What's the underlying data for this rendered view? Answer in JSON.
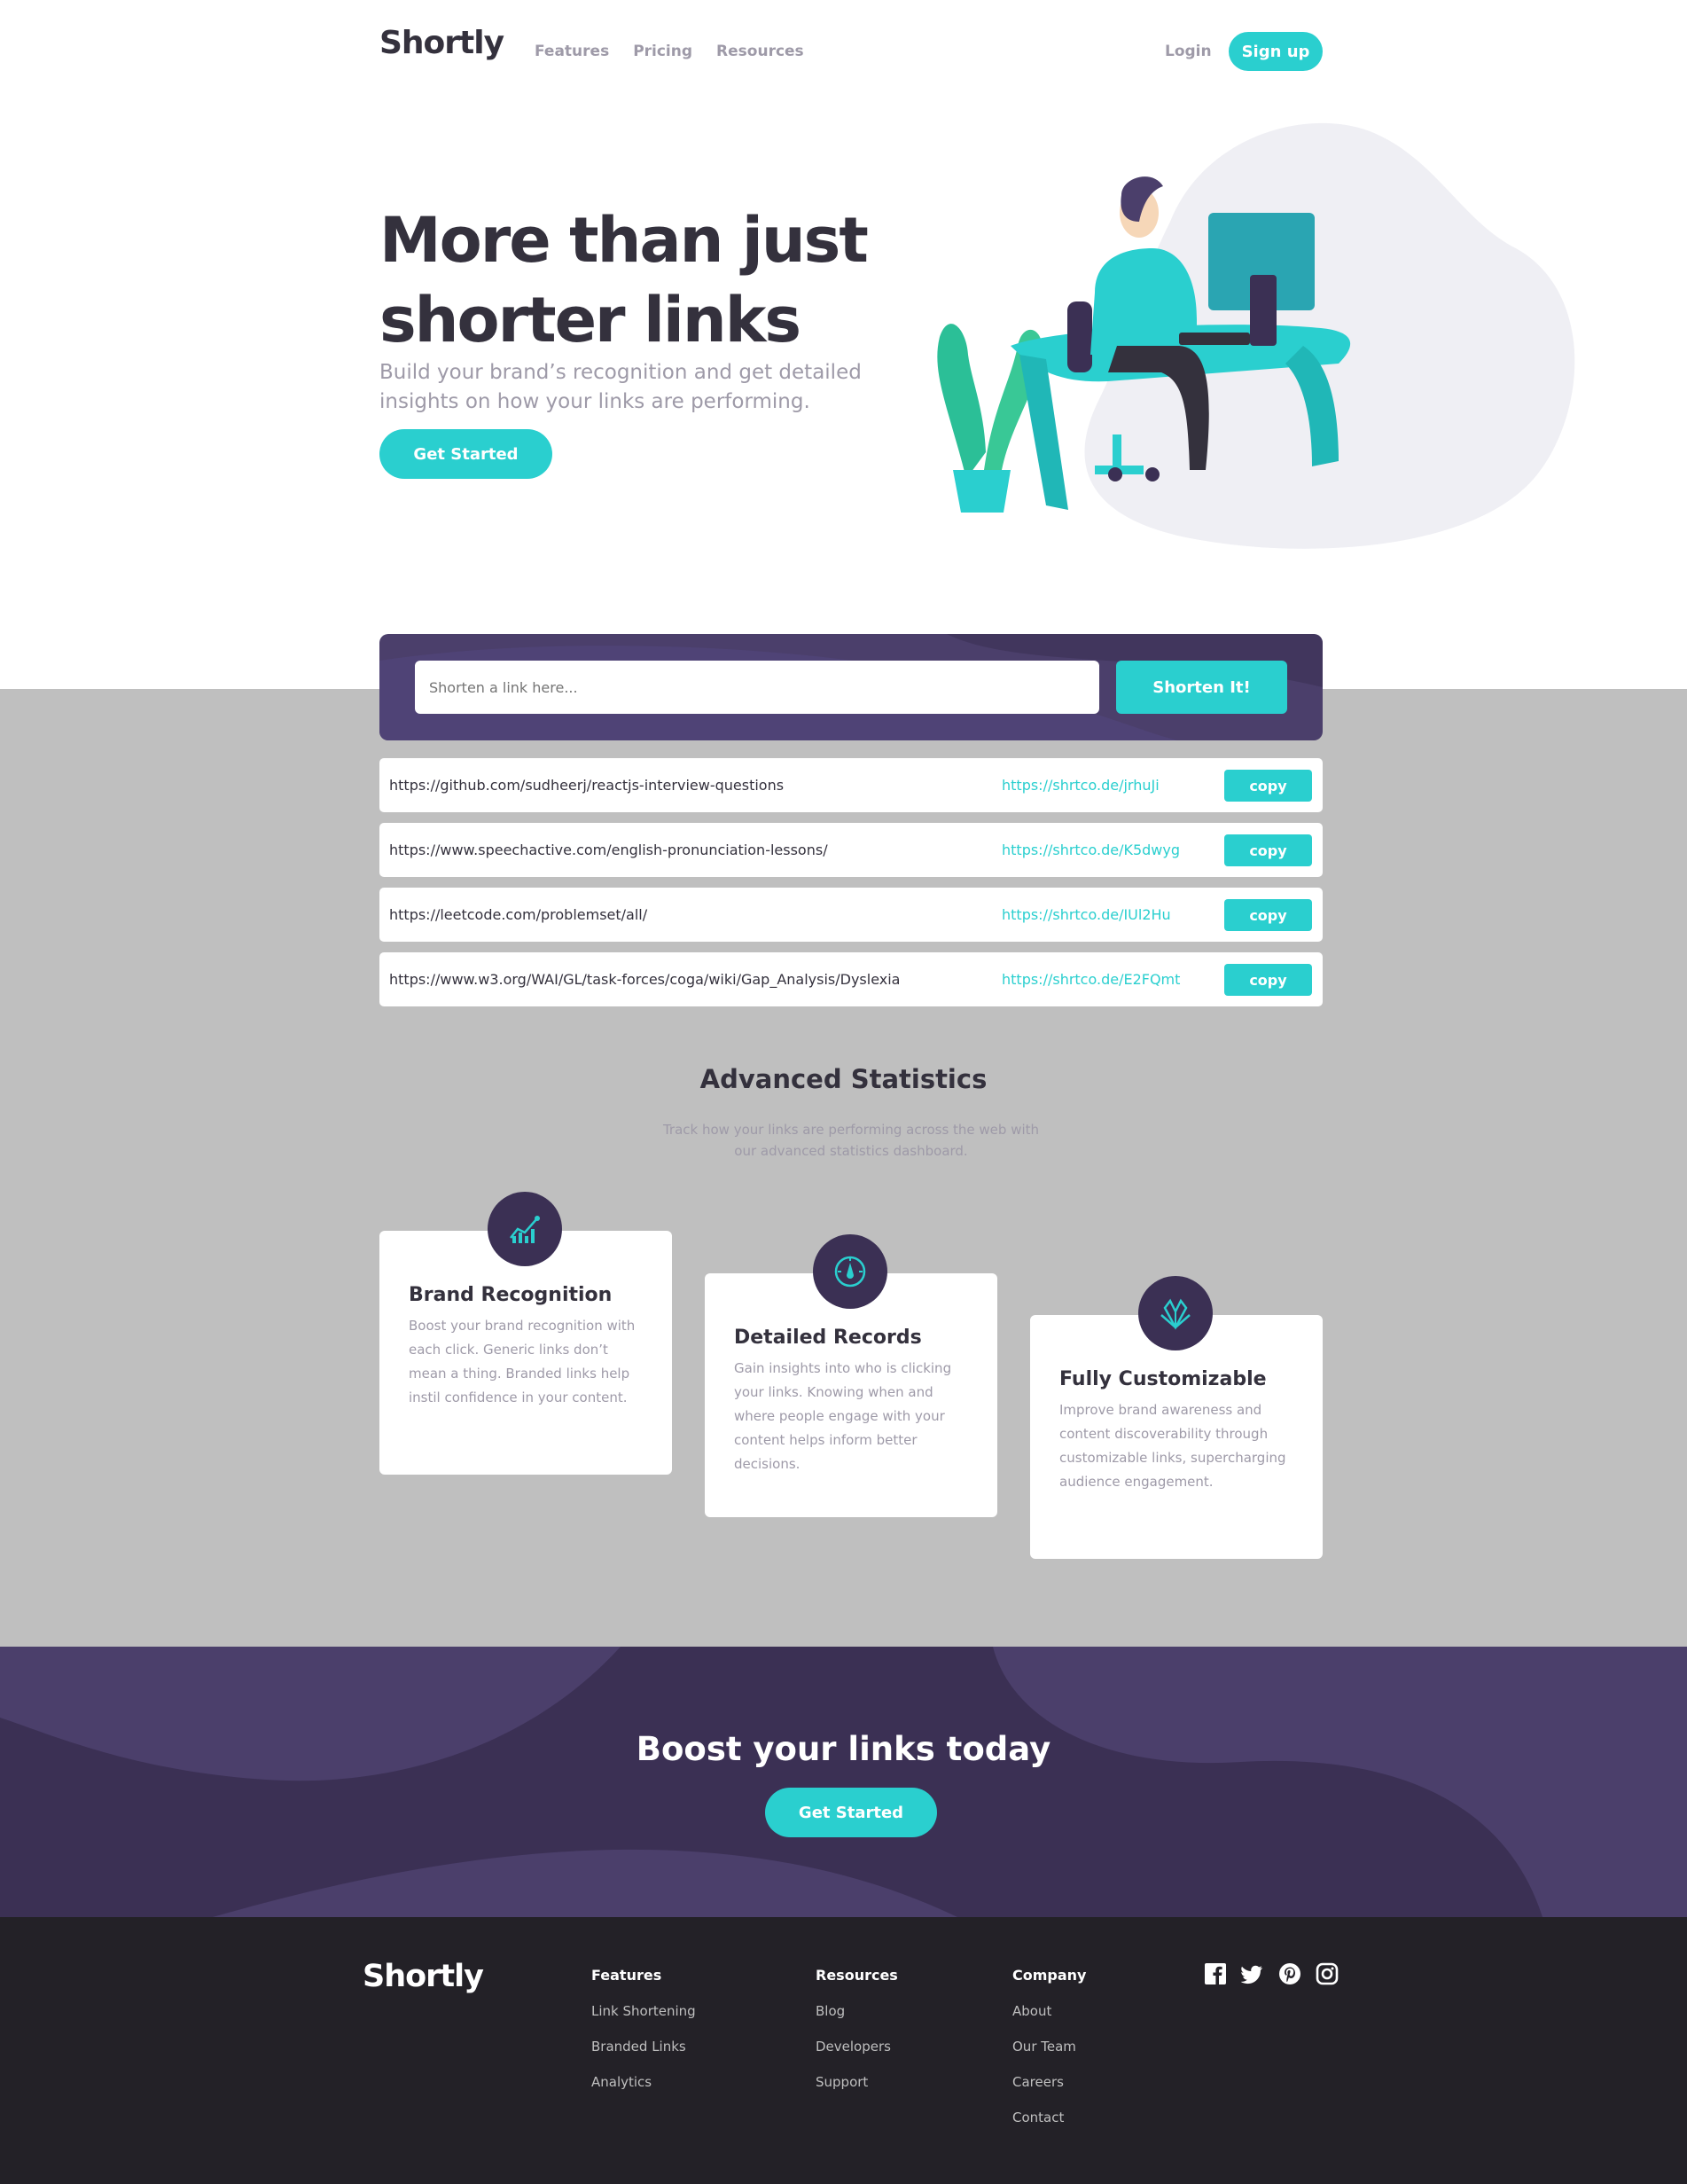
{
  "header": {
    "logo": "Shortly",
    "nav": [
      "Features",
      "Pricing",
      "Resources"
    ],
    "login": "Login",
    "signup": "Sign up"
  },
  "hero": {
    "title": "More than just shorter links",
    "subtitle": "Build your brand’s recognition and get detailed insights on how your links are performing.",
    "cta": "Get Started"
  },
  "shorten": {
    "placeholder": "Shorten a link here...",
    "button": "Shorten It!"
  },
  "results": [
    {
      "original": "https://github.com/sudheerj/reactjs-interview-questions",
      "short": "https://shrtco.de/jrhuJi",
      "copy": "copy"
    },
    {
      "original": "https://www.speechactive.com/english-pronunciation-lessons/",
      "short": "https://shrtco.de/K5dwyg",
      "copy": "copy"
    },
    {
      "original": "https://leetcode.com/problemset/all/",
      "short": "https://shrtco.de/IUl2Hu",
      "copy": "copy"
    },
    {
      "original": "https://www.w3.org/WAI/GL/task-forces/coga/wiki/Gap_Analysis/Dyslexia",
      "short": "https://shrtco.de/E2FQmt",
      "copy": "copy"
    }
  ],
  "stats": {
    "title": "Advanced Statistics",
    "subtitle": "Track how your links are performing across the web with our advanced statistics dashboard.",
    "cards": [
      {
        "icon": "brand-recognition-icon",
        "title": "Brand Recognition",
        "text": "Boost your brand recognition with each click. Generic links don’t mean a thing. Branded links help instil confidence in your content."
      },
      {
        "icon": "detailed-records-icon",
        "title": "Detailed Records",
        "text": "Gain insights into who is clicking your links. Knowing when and where people engage with your content helps inform better decisions."
      },
      {
        "icon": "fully-customizable-icon",
        "title": "Fully Customizable",
        "text": "Improve brand awareness and content discoverability through customizable links, supercharging audience engagement."
      }
    ]
  },
  "boost": {
    "title": "Boost your links today",
    "cta": "Get Started"
  },
  "footer": {
    "logo": "Shortly",
    "columns": [
      {
        "heading": "Features",
        "links": [
          "Link Shortening",
          "Branded Links",
          "Analytics"
        ]
      },
      {
        "heading": "Resources",
        "links": [
          "Blog",
          "Developers",
          "Support"
        ]
      },
      {
        "heading": "Company",
        "links": [
          "About",
          "Our Team",
          "Careers",
          "Contact"
        ]
      }
    ],
    "social": [
      "facebook-icon",
      "twitter-icon",
      "pinterest-icon",
      "instagram-icon"
    ]
  },
  "colors": {
    "cyan": "#2acfcf",
    "dark_violet": "#3b3054",
    "grayish_violet": "#9e9aa8",
    "very_dark_blue": "#34313d",
    "footer_bg": "#232127",
    "section_gray": "#bfbfbf"
  }
}
